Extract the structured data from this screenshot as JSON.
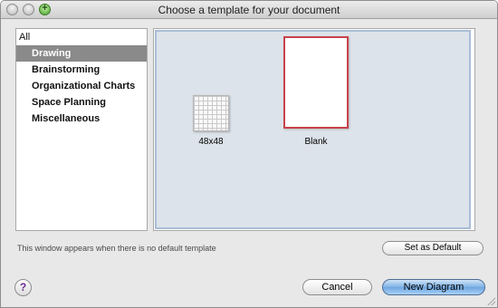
{
  "window": {
    "title": "Choose a template for your document"
  },
  "sidebar": {
    "items": [
      {
        "label": "All",
        "selected": false
      },
      {
        "label": "Drawing",
        "selected": true
      },
      {
        "label": "Brainstorming",
        "selected": false
      },
      {
        "label": "Organizational Charts",
        "selected": false
      },
      {
        "label": "Space Planning",
        "selected": false
      },
      {
        "label": "Miscellaneous",
        "selected": false
      }
    ]
  },
  "templates": [
    {
      "label": "48x48",
      "icon": "grid-template-icon",
      "selected": false
    },
    {
      "label": "Blank",
      "icon": "blank-page-icon",
      "selected": true
    }
  ],
  "footer": {
    "hint": "This window appears when there is no default template",
    "set_default_label": "Set as Default",
    "help_label": "?",
    "cancel_label": "Cancel",
    "new_diagram_label": "New Diagram"
  },
  "colors": {
    "selection": "#8a8a8a",
    "template_highlight": "#c8424a",
    "primary_button": "#7fb2e5",
    "gallery_background": "#dde3ea"
  }
}
